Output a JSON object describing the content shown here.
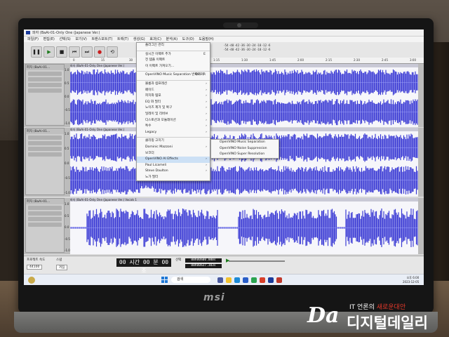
{
  "app": {
    "title": "파자 (BaAi-01-Only One (Japanese Ver.)",
    "menubar": [
      "파일(F)",
      "편집(E)",
      "선택(S)",
      "보기(V)",
      "트랜스포트(T)",
      "트랙(T)",
      "생성(G)",
      "효과(C)",
      "분석(A)",
      "도구(O)",
      "도움말(H)"
    ],
    "toolbar": {
      "pause": "❚❚",
      "play": "▶",
      "stop": "■",
      "prev": "⏮",
      "next": "⏭",
      "record": "●",
      "loop": "⟲"
    },
    "meters": [
      "-54 -48 -42 -36 -30 -24 -18 -12 -6",
      "-54 -48 -42 -36 -30 -24 -18 -12 -6"
    ],
    "ruler_ticks": [
      "0",
      "15",
      "30",
      "45",
      "1:00",
      "1:15",
      "1:30",
      "1:45",
      "2:00",
      "2:15",
      "2:30",
      "2:45",
      "3:00"
    ]
  },
  "tracks": [
    {
      "name": "파자 (BaAi-01...",
      "clip": "파자 (BaAi-01-Only One (Japanese Ver.)",
      "scale": [
        "1.0",
        "0.5",
        "0.0",
        "-0.5",
        "-1.0"
      ]
    },
    {
      "name": "파자 (BaAi-01...",
      "clip": "파자 (BaAi-01-Only One (Japanese Ver.)",
      "scale": [
        "1.0",
        "0.5",
        "0.0",
        "-0.5",
        "-1.0"
      ]
    },
    {
      "name": "파자 (BaAi-01...",
      "clip": "파자 (BaAi-01-Only One (Japanese Ver.) Vocals 1",
      "scale": [
        "1.0",
        "0.5",
        "0.0",
        "-0.5",
        "-1.0"
      ]
    }
  ],
  "bottom": {
    "rate_label": "프로젝트 속도",
    "snap_label": "스냅",
    "rate_value": "44100",
    "snap_value": "꺼짐",
    "timer": "00 시간 00 분 00 초",
    "selection_label": "선택",
    "sel_start": "00h00m00.000s",
    "sel_end": "00h00m37.303s"
  },
  "taskbar": {
    "search_placeholder": "검색",
    "clock_time": "오후 6:00",
    "clock_date": "2023-12-05"
  },
  "effects_menu": {
    "items": [
      {
        "label": "플러그인 관리",
        "shortcut": "",
        "arrow": false
      },
      {
        "label": "",
        "sep": true
      },
      {
        "label": "실시간 이펙트 추가",
        "shortcut": "E",
        "arrow": false
      },
      {
        "label": "전 템플 이펙트",
        "shortcut": "",
        "arrow": false
      },
      {
        "label": "이 이펙트 가져오기...",
        "shortcut": "",
        "arrow": false
      },
      {
        "label": "",
        "sep": true
      },
      {
        "label": "OpenVINO Music Separation 반복하기",
        "shortcut": "Ctrl+R",
        "arrow": false
      },
      {
        "label": "",
        "sep": true
      },
      {
        "label": "볼륨과 컴프레션",
        "shortcut": "",
        "arrow": true
      },
      {
        "label": "페이드",
        "shortcut": "",
        "arrow": true
      },
      {
        "label": "피치와 템포",
        "shortcut": "",
        "arrow": true
      },
      {
        "label": "EQ 와 필터",
        "shortcut": "",
        "arrow": true
      },
      {
        "label": "노이즈 제거 및 복구",
        "shortcut": "",
        "arrow": true
      },
      {
        "label": "딜레이 및 리버브",
        "shortcut": "",
        "arrow": true
      },
      {
        "label": "디스토션과 모듈레이션",
        "shortcut": "",
        "arrow": true
      },
      {
        "label": "특수",
        "shortcut": "",
        "arrow": true
      },
      {
        "label": "Legacy",
        "shortcut": "",
        "arrow": true
      },
      {
        "label": "",
        "sep": true
      },
      {
        "label": "클리핑 고치기",
        "shortcut": "",
        "arrow": false
      },
      {
        "label": "Dominic Mazzoni",
        "shortcut": "",
        "arrow": true
      },
      {
        "label": "보코더",
        "shortcut": "",
        "arrow": false
      },
      {
        "label": "OpenVINO AI Effects",
        "shortcut": "",
        "arrow": true,
        "highlight": true
      },
      {
        "label": "Paul Licameli",
        "shortcut": "",
        "arrow": true
      },
      {
        "label": "Steve Daulton",
        "shortcut": "",
        "arrow": true
      },
      {
        "label": "노가 필터",
        "shortcut": "",
        "arrow": false
      }
    ]
  },
  "submenu": {
    "items": [
      "OpenVINO Music Separation",
      "OpenVINO Noise Suppression",
      "OpenVINO Super Resolution"
    ]
  },
  "watermark": {
    "tagline_pre": "IT 언론의 ",
    "tagline_hl": "새로운대안",
    "name": "디지털데일리",
    "logo": "Da"
  },
  "brand": "msi",
  "colors": {
    "wave": "#3a3ad4",
    "screen_bg": "#d8d8d8",
    "menu_hl": "#cce0f5",
    "accent_red": "#e8392b"
  }
}
